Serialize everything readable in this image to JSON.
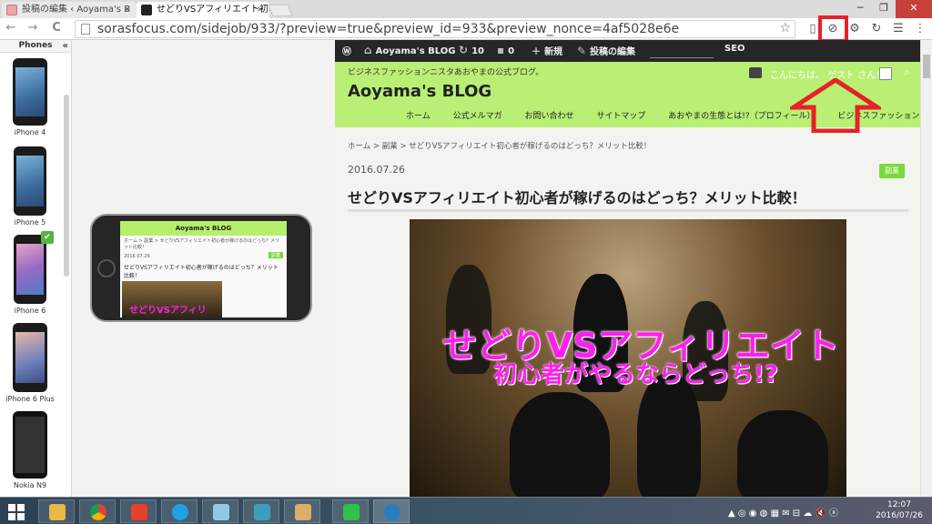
{
  "tabs": [
    {
      "title": "投稿の編集 ‹ Aoyama's B",
      "close": "×"
    },
    {
      "title": "せどりVSアフィリエイト初心者",
      "close": "×"
    }
  ],
  "window": {
    "minimize": "─",
    "restore": "❐",
    "close": "✕"
  },
  "toolbar": {
    "back": "←",
    "forward": "→",
    "reload": "C",
    "url": "sorasfocus.com/sidejob/933/?preview=true&preview_id=933&preview_nonce=4af5028e6e",
    "star": "☆"
  },
  "extensions": [
    "phone-icon",
    "rotate-icon",
    "gear-icon",
    "refresh-icon",
    "list-icon",
    "menu-icon"
  ],
  "sidebar": {
    "heading": "Phones",
    "collapse": "«",
    "devices": [
      {
        "label": "iPhone 4"
      },
      {
        "label": "iPhone 5"
      },
      {
        "label": "iPhone 6",
        "selected": true
      },
      {
        "label": "iPhone 6 Plus"
      },
      {
        "label": "Nokia N9"
      }
    ],
    "check": "✔"
  },
  "mini_preview": {
    "logo": "Aoyama's BLOG",
    "crumb": "ホーム > 副業 > せどりVSアフィリエイト初心者が稼げるのはどっち？メリット比較！",
    "date": "2016.07.26",
    "cat": "副業",
    "title": "せどりVSアフィリエイト初心者が稼げるのはどっち？メリット比較！",
    "image_text": "せどりVSアフィリ"
  },
  "adminbar": {
    "site": "Aoyama's BLOG",
    "updates": "10",
    "comments": "0",
    "new": "新規",
    "edit": "投稿の編集",
    "seo": "SEO"
  },
  "site": {
    "tagline": "ビジネスファッションニスタあおやまの公式ブログ。",
    "logo": "Aoyama's BLOG",
    "hello": "こんにちは、 ゲスト さん！",
    "menu": [
      "ホーム",
      "公式メルマガ",
      "お問い合わせ",
      "サイトマップ",
      "あおやまの生態とは!?（プロフィール）",
      "ビジネスファッションニスタとは。"
    ]
  },
  "post": {
    "breadcrumb": "ホーム > 副業 > せどりVSアフィリエイト初心者が稼げるのはどっち？メリット比較！",
    "date": "2016.07.26",
    "category": "副業",
    "title": "せどりVSアフィリエイト初心者が稼げるのはどっち？メリット比較！",
    "hero_line1": "せどりVSアフィリエイト",
    "hero_line2": "初心者がやるならどっち!?"
  },
  "taskbar": {
    "apps": [
      "explorer",
      "chrome",
      "app-red",
      "skype",
      "app-blue",
      "app-green",
      "paint",
      "line",
      "app-hex"
    ],
    "tray": "▲ ◎ ◉ ◍ ▦ ✉ ⊟ ☁ 🔇 ⓧ",
    "time": "12:07",
    "date": "2016/07/26"
  },
  "colors": {
    "highlight": "#e52227",
    "header": "#b9ef74",
    "title_pink": "#ff1df2"
  }
}
